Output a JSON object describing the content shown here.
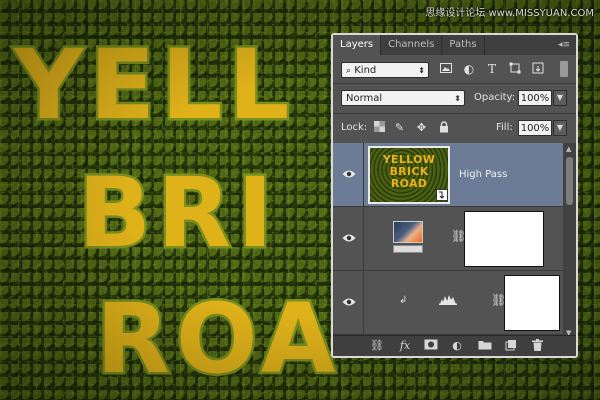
{
  "watermark": "思缘设计论坛 www.MISSYUAN.COM",
  "canvas": {
    "words": [
      "YELL",
      "BRI",
      "ROA"
    ]
  },
  "panel": {
    "tabs": [
      {
        "label": "Layers",
        "active": true
      },
      {
        "label": "Channels",
        "active": false
      },
      {
        "label": "Paths",
        "active": false
      }
    ],
    "filter": {
      "kind_label": "Kind",
      "icons": [
        "image-filter-icon",
        "adjustment-filter-icon",
        "type-filter-icon",
        "shape-filter-icon",
        "smart-object-filter-icon"
      ]
    },
    "blend_mode": "Normal",
    "opacity_label": "Opacity:",
    "opacity_value": "100%",
    "lock_label": "Lock:",
    "fill_label": "Fill:",
    "fill_value": "100%",
    "layers": [
      {
        "name": "High Pass",
        "thumb_text": [
          "YELLOW",
          "BRICK",
          "ROAD"
        ],
        "selected": true,
        "visible": true
      },
      {
        "name": "",
        "type": "gradient-adjustment",
        "visible": true
      },
      {
        "name": "",
        "type": "levels-adjustment",
        "visible": true
      }
    ],
    "footer_icons": [
      "link-layers-icon",
      "fx-icon",
      "add-mask-icon",
      "adjustment-layer-icon",
      "new-group-icon",
      "new-layer-icon",
      "trash-icon"
    ],
    "colors": {
      "selected_row": "#6c7b96",
      "panel_bg": "#535353",
      "letter_fill": "#e0b21a"
    }
  }
}
